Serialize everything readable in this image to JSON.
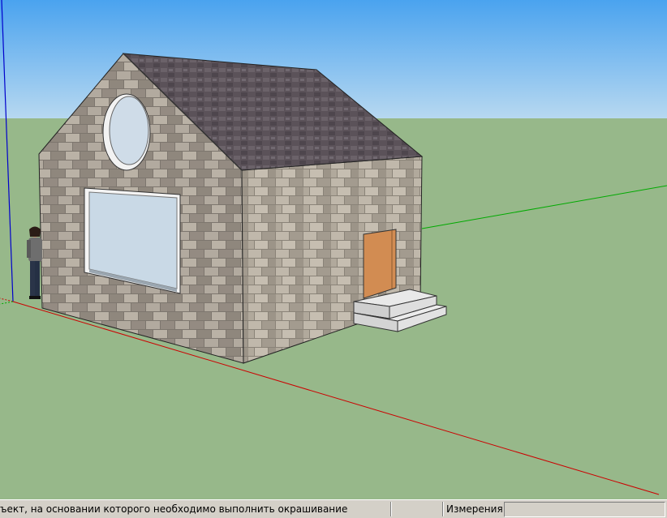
{
  "statusbar": {
    "hint_text": "ъект, на основании которого необходимо выполнить окрашивание",
    "measurements_label": "Измерения",
    "measurements_value": ""
  },
  "scene": {
    "sky_color": "#6fb3ea",
    "ground_color": "#97b88a",
    "axis_red": "#cc0000",
    "axis_green": "#00aa00",
    "axis_blue": "#0000cc",
    "roof_color": "#5e5560",
    "wall_color": "#a29a90",
    "door_color": "#d28c52",
    "glass_color": "#c9d9e6"
  }
}
